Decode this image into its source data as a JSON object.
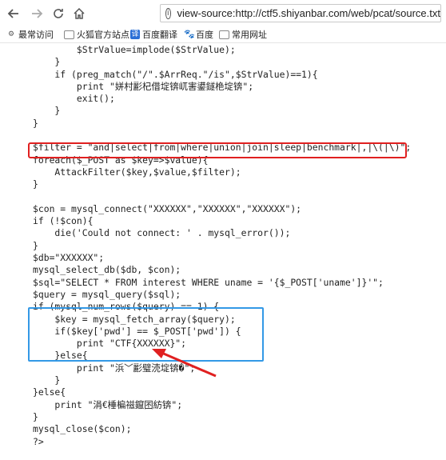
{
  "toolbar": {
    "back_icon": "back-arrow-icon",
    "forward_icon": "forward-arrow-icon",
    "reload_icon": "reload-icon",
    "home_icon": "home-icon",
    "url": "view-source:http://ctf5.shiyanbar.com/web/pcat/source.txt"
  },
  "bookmarks": [
    {
      "label": "最常访问",
      "icon": "gear-icon",
      "color": "#555555"
    },
    {
      "label": "火狐官方站点",
      "icon": "folder-icon",
      "color": "#888888"
    },
    {
      "label": "百度翻译",
      "icon": "translate-icon",
      "color": "#2b6fd6"
    },
    {
      "label": "百度",
      "icon": "paw-icon",
      "color": "#2b6fd6"
    },
    {
      "label": "常用网址",
      "icon": "folder-icon",
      "color": "#888888"
    }
  ],
  "code_lines": [
    "        $StrValue=implode($StrValue);",
    "    }",
    "    if (preg_match(\"/\".$ArrReq.\"/is\",$StrValue)==1){",
    "        print \"姘村彲杞借埞锛屼害鍙鐩栬埞锛\";",
    "        exit();",
    "    }",
    "}",
    "",
    "$filter = \"and|select|from|where|union|join|sleep|benchmark|,|\\(|\\)\";",
    "foreach($_POST as $key=>$value){",
    "    AttackFilter($key,$value,$filter);",
    "}",
    "",
    "$con = mysql_connect(\"XXXXXX\",\"XXXXXX\",\"XXXXXX\");",
    "if (!$con){",
    "    die('Could not connect: ' . mysql_error());",
    "}",
    "$db=\"XXXXXX\";",
    "mysql_select_db($db, $con);",
    "$sql=\"SELECT * FROM interest WHERE uname = '{$_POST['uname']}'\";",
    "$query = mysql_query($sql);",
    "if (mysql_num_rows($query) == 1) {",
    "    $key = mysql_fetch_array($query);",
    "    if($key['pwd'] == $_POST['pwd']) {",
    "        print \"CTF{XXXXXX}\";",
    "    }else{",
    "        print \"浜﹀彲璧涜埞锛�\";",
    "    }",
    "}else{",
    "    print \"涓€棰楄禌鑹囨紡锛\";",
    "}",
    "mysql_close($con);",
    "?>"
  ]
}
